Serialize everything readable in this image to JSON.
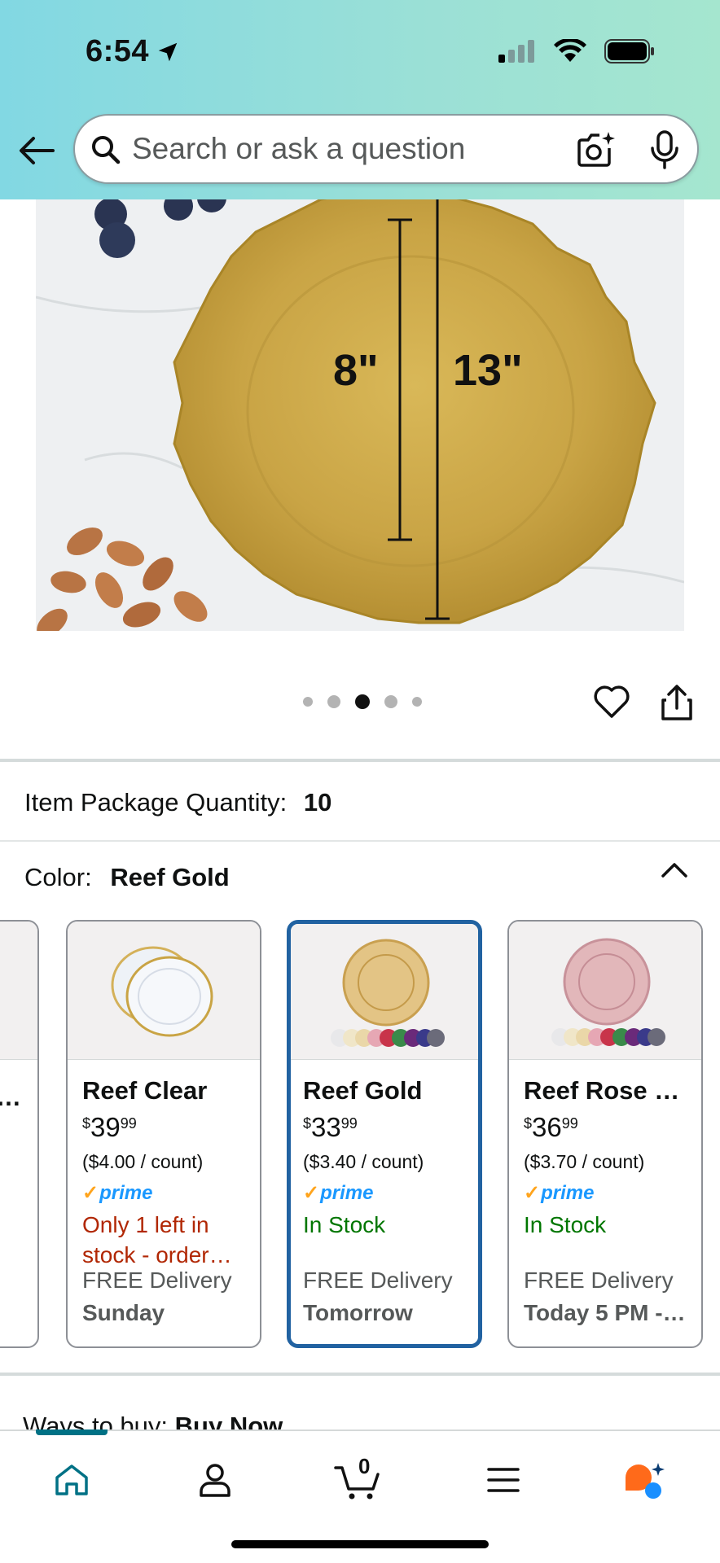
{
  "status_bar": {
    "time": "6:54"
  },
  "search": {
    "placeholder": "Search or ask a question"
  },
  "product_image": {
    "dim_inner": "8\"",
    "dim_outer": "13\""
  },
  "carousel": {
    "count": 5,
    "active_index": 2
  },
  "item_package": {
    "label": "Item Package Quantity:",
    "value": "10"
  },
  "color": {
    "label": "Color:",
    "value": "Reef Gold"
  },
  "swatches": [
    {
      "name": "…",
      "delivery_day": ""
    },
    {
      "name": "Reef Clear",
      "dollars": "39",
      "cents": "99",
      "unit_price": "($4.00 / count)",
      "prime": "prime",
      "stock": "Only 1 left in stock - order…",
      "delivery": "FREE Delivery",
      "delivery_day": "Sunday"
    },
    {
      "name": "Reef Gold",
      "dollars": "33",
      "cents": "99",
      "unit_price": "($3.40 / count)",
      "prime": "prime",
      "stock": "In Stock",
      "delivery": "FREE Delivery",
      "delivery_day": "Tomorrow"
    },
    {
      "name": "Reef Rose …",
      "dollars": "36",
      "cents": "99",
      "unit_price": "($3.70 / count)",
      "prime": "prime",
      "stock": "In Stock",
      "delivery": "FREE Delivery",
      "delivery_day": "Today 5 PM -…"
    }
  ],
  "ways_to_buy": {
    "label": "Ways to buy:",
    "value": "Buy Now"
  },
  "cart": {
    "count": "0"
  },
  "colors": {
    "accent": "#007185",
    "selected_border": "#2162a1",
    "prime_blue": "#1a98ff",
    "in_stock": "#007600",
    "low_stock": "#b12704"
  }
}
